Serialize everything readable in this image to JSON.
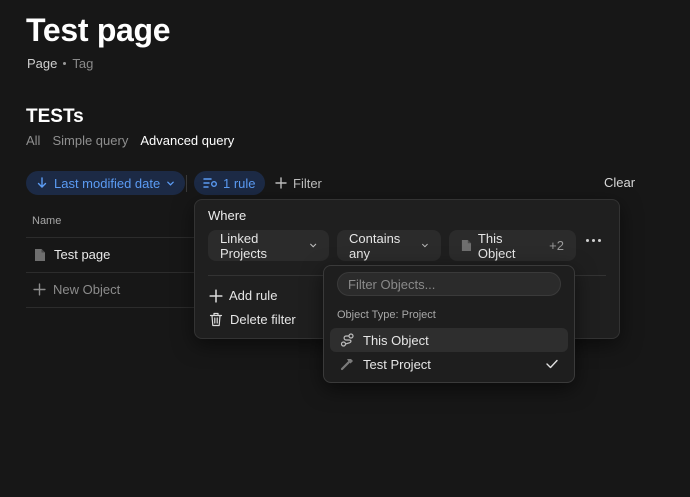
{
  "page": {
    "title": "Test page",
    "props": [
      "Page",
      "Tag"
    ]
  },
  "section": {
    "title": "TESTs",
    "views": [
      {
        "label": "All",
        "active": false
      },
      {
        "label": "Simple query",
        "active": false
      },
      {
        "label": "Advanced query",
        "active": true
      }
    ]
  },
  "toolbar": {
    "sort_label": "Last modified date",
    "rule_label": "1 rule",
    "filter_label": "Filter",
    "clear_label": "Clear",
    "accent_color": "#5b9bf3"
  },
  "table": {
    "column_header": "Name",
    "rows": [
      {
        "label": "Test page",
        "icon": "page-icon"
      }
    ],
    "new_label": "New Object"
  },
  "filter_panel": {
    "where_label": "Where",
    "property_label": "Linked Projects",
    "condition_label": "Contains any",
    "value_label": "This Object",
    "value_more": "+2",
    "add_rule_label": "Add rule",
    "delete_filter_label": "Delete filter"
  },
  "object_picker": {
    "search_placeholder": "Filter Objects...",
    "type_label": "Object Type: Project",
    "items": [
      {
        "label": "This Object",
        "icon": "link-icon",
        "highlighted": true,
        "checked": false
      },
      {
        "label": "Test Project",
        "icon": "hammer-icon",
        "highlighted": false,
        "checked": true
      }
    ]
  }
}
